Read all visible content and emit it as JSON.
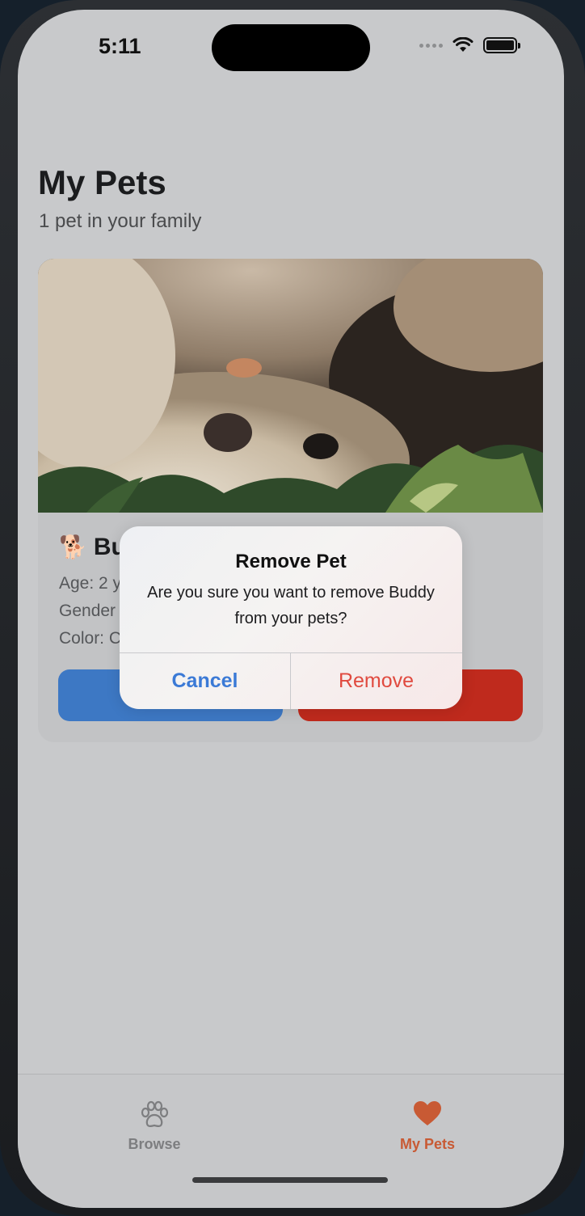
{
  "status_bar": {
    "time": "5:11"
  },
  "header": {
    "title": "My Pets",
    "subtitle": "1 pet in your family"
  },
  "pet_card": {
    "emoji": "🐕",
    "name_visible": "Bu",
    "details": [
      "Age: 2 y",
      "Gender",
      "Color: C"
    ]
  },
  "dialog": {
    "title": "Remove Pet",
    "message": "Are you sure you want to remove Buddy from your pets?",
    "cancel_label": "Cancel",
    "remove_label": "Remove"
  },
  "tab_bar": {
    "tabs": [
      {
        "label": "Browse",
        "icon": "paw-icon",
        "selected": false
      },
      {
        "label": "My Pets",
        "icon": "heart-icon",
        "selected": true
      }
    ]
  },
  "colors": {
    "accent_blue": "#3d78c4",
    "destructive_red": "#bf2a1d",
    "tab_selected": "#c85a34",
    "dialog_cancel": "#3b7ad6",
    "dialog_remove": "#e04a3f"
  }
}
